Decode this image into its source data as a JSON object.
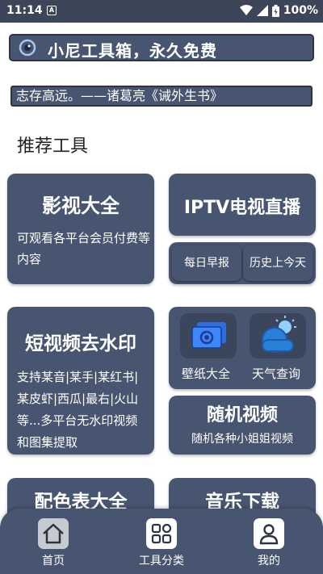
{
  "status": {
    "time": "11:14",
    "notification_badge": "A",
    "battery": "100%"
  },
  "banner": {
    "title": "小尼工具箱，永久免费"
  },
  "quote": "志存高远。——诸葛亮《诫外生书》",
  "section_title": "推荐工具",
  "cards": {
    "video": {
      "title": "影视大全",
      "desc": "可观看各平台会员付费等内容"
    },
    "iptv": {
      "title": "IPTV电视直播"
    },
    "daily": {
      "left": "每日早报",
      "right": "历史上今天"
    },
    "watermark": {
      "title": "短视频去水印",
      "desc": "支持某音|某手|某红书|某皮虾|西瓜|最右|火山等...多平台无水印视频和图集提取"
    },
    "wallpaper_label": "壁纸大全",
    "weather_label": "天气查询",
    "random_video": {
      "title": "随机视频",
      "desc": "随机各种小姐姐视频"
    },
    "color_table": {
      "title": "配色表大全"
    },
    "music": {
      "title": "音乐下载"
    }
  },
  "nav": {
    "home": "首页",
    "tools": "工具分类",
    "mine": "我的"
  },
  "colors": {
    "card": "#485570",
    "status_bar": "#3c4658",
    "nav_active": "#c7cacf"
  }
}
